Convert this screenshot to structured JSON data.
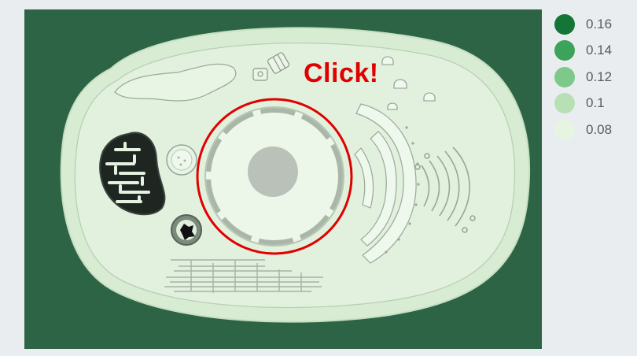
{
  "prompt": {
    "text": "Click!",
    "color": "#e00000"
  },
  "legend": {
    "items": [
      {
        "label": "0.16",
        "color": "#137637"
      },
      {
        "label": "0.14",
        "color": "#3ea35a"
      },
      {
        "label": "0.12",
        "color": "#7ec98a"
      },
      {
        "label": "0.1",
        "color": "#b7e1b4"
      },
      {
        "label": "0.08",
        "color": "#e6f5e2"
      }
    ]
  },
  "cell": {
    "background_color": "#2e6446",
    "cytoplasm_color": "#d7ecd3",
    "nucleus_fill_color": "#ecf7ea",
    "highlight_ring_color": "#e00000"
  }
}
